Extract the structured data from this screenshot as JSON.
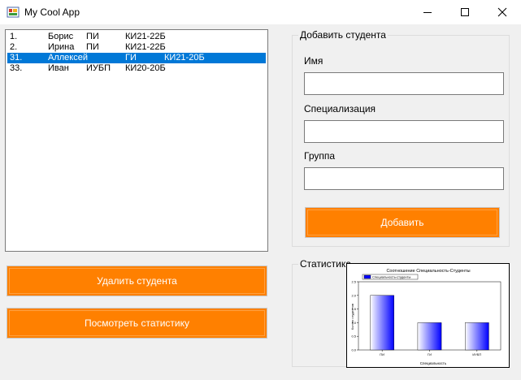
{
  "window": {
    "title": "My Cool App",
    "icons": {
      "app": "app-icon",
      "minimize": "minimize-icon",
      "maximize": "maximize-icon",
      "close": "close-icon"
    }
  },
  "students": [
    {
      "num": "1.",
      "name": "Борис",
      "spec": "ПИ",
      "group": "КИ21-22Б",
      "selected": false
    },
    {
      "num": "2.",
      "name": "Ирина",
      "spec": "ПИ",
      "group": "КИ21-22Б",
      "selected": false
    },
    {
      "num": "31.",
      "name": "Аллексей",
      "spec": "ГИ",
      "group": "КИ21-20Б",
      "selected": true
    },
    {
      "num": "33.",
      "name": "Иван",
      "spec": "ИУБП",
      "group": "КИ20-20Б",
      "selected": false
    }
  ],
  "buttons": {
    "delete": "Удалить студента",
    "stats": "Посмотреть статистику",
    "add": "Добавить"
  },
  "add_form": {
    "title": "Добавить студента",
    "name_label": "Имя",
    "spec_label": "Специализация",
    "group_label": "Группа",
    "name_value": "",
    "spec_value": "",
    "group_value": ""
  },
  "stats_group": {
    "title": "Статистика"
  },
  "colors": {
    "accent": "#ff8000",
    "selection": "#0078d7",
    "bar": "#0000ff"
  },
  "chart_data": {
    "type": "bar",
    "title": "Соотношение Специальность-Студенты",
    "xlabel": "Специальность",
    "ylabel": "Кол-во студентов",
    "legend": "Специальность-студенты",
    "legend_position": "top-left",
    "categories": [
      "ПИ",
      "ГИ",
      "ИУБП"
    ],
    "values": [
      2,
      1,
      1
    ],
    "yticks": [
      "0.0",
      "0.5",
      "1.0",
      "1.5",
      "2.0",
      "2.5"
    ],
    "ylim": [
      0,
      2.5
    ],
    "grid": false
  }
}
